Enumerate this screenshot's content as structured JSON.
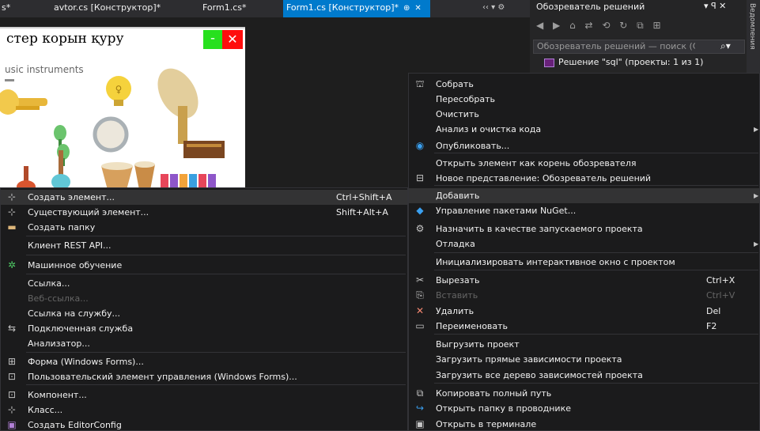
{
  "tabs": [
    {
      "label": "s*"
    },
    {
      "label": "avtor.cs [Конструктор]*"
    },
    {
      "label": "Form1.cs*"
    },
    {
      "label": "Form1.cs [Конструктор]*",
      "pin": "⊕",
      "close": "✕"
    }
  ],
  "tab_controls": "‹‹ ▾ ⚙",
  "designer": {
    "form_title": "стер корын қуру",
    "minimize_label": "–",
    "close_label": "✕",
    "label_text": "usic instruments"
  },
  "solution_explorer": {
    "title": "Обозреватель решений",
    "title_controls": "▾ ꟼ ✕",
    "toolbar": "◀ ▶ ⌂ ⇄ ⟲ ↻ ⧉ ⊞",
    "search_placeholder": "Обозреватель решений — поиск (Ctrl+;",
    "search_icon": "search-icon",
    "solution_label": "Решение \"sql\" (проекты: 1 из 1)",
    "side_strip_label": "Ведомления"
  },
  "right_menu": {
    "items": [
      {
        "icon": "build-icon",
        "glyph": "⛫",
        "label": "Собрать"
      },
      {
        "icon": "",
        "glyph": "",
        "label": "Пересобрать"
      },
      {
        "icon": "",
        "glyph": "",
        "label": "Очистить"
      },
      {
        "icon": "",
        "glyph": "",
        "label": "Анализ и очистка кода",
        "arrow": "▶"
      },
      {
        "icon": "publish-icon",
        "glyph": "◉",
        "label": "Опубликовать..."
      },
      {
        "icon": "",
        "glyph": "",
        "label": "Открыть элемент как корень обозревателя"
      },
      {
        "icon": "new-view-icon",
        "glyph": "⊟",
        "label": "Новое представление: Обозреватель решений"
      },
      {
        "icon": "",
        "glyph": "",
        "label": "Добавить",
        "arrow": "▶",
        "highlight": true
      },
      {
        "icon": "nuget-icon",
        "glyph": "◆",
        "label": "Управление пакетами NuGet..."
      },
      {
        "icon": "gear-icon",
        "glyph": "⚙",
        "label": "Назначить в качестве запускаемого проекта"
      },
      {
        "icon": "",
        "glyph": "",
        "label": "Отладка",
        "arrow": "▶"
      },
      {
        "icon": "",
        "glyph": "",
        "label": "Инициализировать интерактивное окно с проектом"
      },
      {
        "icon": "cut-icon",
        "glyph": "✂",
        "label": "Вырезать",
        "shortcut": "Ctrl+X"
      },
      {
        "icon": "paste-icon",
        "glyph": "⎘",
        "label": "Вставить",
        "shortcut": "Ctrl+V",
        "disabled": true
      },
      {
        "icon": "delete-icon",
        "glyph": "✕",
        "label": "Удалить",
        "shortcut": "Del"
      },
      {
        "icon": "rename-icon",
        "glyph": "▭",
        "label": "Переименовать",
        "shortcut": "F2"
      },
      {
        "icon": "",
        "glyph": "",
        "label": "Выгрузить проект"
      },
      {
        "icon": "",
        "glyph": "",
        "label": "Загрузить прямые зависимости проекта"
      },
      {
        "icon": "",
        "glyph": "",
        "label": "Загрузить все дерево зависимостей проекта"
      },
      {
        "icon": "copy-path-icon",
        "glyph": "⧉",
        "label": "Копировать полный путь"
      },
      {
        "icon": "open-folder-icon",
        "glyph": "↪",
        "label": "Открыть папку в проводнике"
      },
      {
        "icon": "terminal-icon",
        "glyph": "▣",
        "label": "Открыть в терминале"
      }
    ]
  },
  "left_menu": {
    "items": [
      {
        "icon": "new-item-icon",
        "glyph": "⊹",
        "label": "Создать элемент...",
        "shortcut": "Ctrl+Shift+A",
        "highlight": true
      },
      {
        "icon": "existing-item-icon",
        "glyph": "⊹",
        "label": "Существующий элемент...",
        "shortcut": "Shift+Alt+A"
      },
      {
        "icon": "new-folder-icon",
        "glyph": "▬",
        "label": "Создать папку"
      },
      {
        "icon": "",
        "glyph": "",
        "label": "Клиент REST API..."
      },
      {
        "icon": "ml-icon",
        "glyph": "✲",
        "label": "Машинное обучение"
      },
      {
        "icon": "",
        "glyph": "",
        "label": "Ссылка..."
      },
      {
        "icon": "",
        "glyph": "",
        "label": "Веб-ссылка...",
        "disabled": true
      },
      {
        "icon": "",
        "glyph": "",
        "label": "Ссылка на службу..."
      },
      {
        "icon": "connected-service-icon",
        "glyph": "⇆",
        "label": "Подключенная служба"
      },
      {
        "icon": "",
        "glyph": "",
        "label": "Анализатор..."
      },
      {
        "icon": "form-icon",
        "glyph": "⊞",
        "label": "Форма (Windows Forms)..."
      },
      {
        "icon": "user-control-icon",
        "glyph": "⊡",
        "label": "Пользовательский элемент управления (Windows Forms)..."
      },
      {
        "icon": "component-icon",
        "glyph": "⊡",
        "label": "Компонент..."
      },
      {
        "icon": "class-icon",
        "glyph": "⊹",
        "label": "Класс..."
      },
      {
        "icon": "editorconfig-icon",
        "glyph": "▣",
        "label": "Создать EditorConfig"
      }
    ]
  },
  "colors": {
    "accent": "#007acc",
    "menu_bg": "#1b1b1c",
    "highlight": "#333334",
    "form_close": "#ff0d0d",
    "form_min": "#27e01e"
  }
}
